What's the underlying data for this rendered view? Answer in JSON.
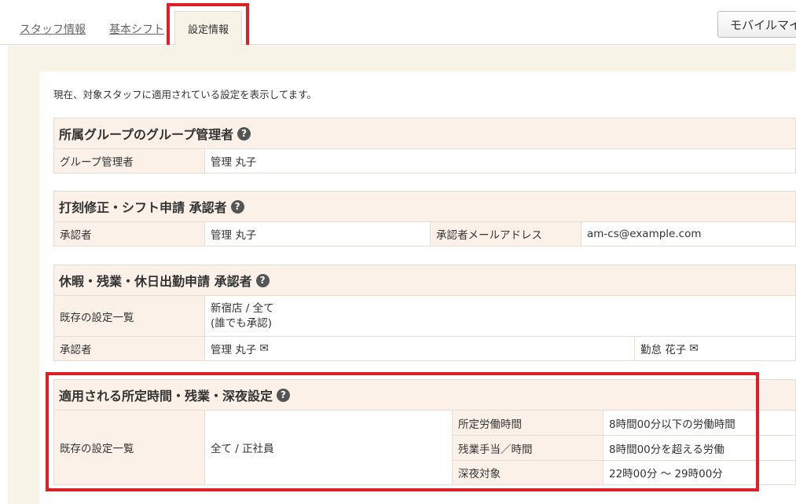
{
  "tabs": {
    "staff": "スタッフ情報",
    "basic_shift": "基本シフト",
    "settings": "設定情報"
  },
  "mobile_button": "モバイルマイ",
  "intro": "現在、対象スタッフに適用されている設定を表示してます。",
  "help_icon": "question-circle",
  "mail_icon": "envelope",
  "group_admin": {
    "title": "所属グループのグループ管理者",
    "label": "グループ管理者",
    "value": "管理 丸子"
  },
  "punch_approver": {
    "title": "打刻修正・シフト申請 承認者",
    "approver_label": "承認者",
    "approver_value": "管理 丸子",
    "email_label": "承認者メールアドレス",
    "email_value": "am-cs@example.com"
  },
  "leave_approver": {
    "title": "休暇・残業・休日出勤申請 承認者",
    "existing_label": "既存の設定一覧",
    "existing_line1": "新宿店 / 全て",
    "existing_line2": "(誰でも承認)",
    "approver_label": "承認者",
    "approver_1": "管理 丸子",
    "approver_2": "勤怠 花子"
  },
  "work_time": {
    "title": "適用される所定時間・残業・深夜設定",
    "existing_label": "既存の設定一覧",
    "target": "全て / 正社員",
    "rows": [
      {
        "label": "所定労働時間",
        "value": "8時間00分以下の労働時間"
      },
      {
        "label": "残業手当／時間",
        "value": "8時間00分を超える労働"
      },
      {
        "label": "深夜対象",
        "value": "22時00分 〜 29時00分"
      }
    ]
  }
}
